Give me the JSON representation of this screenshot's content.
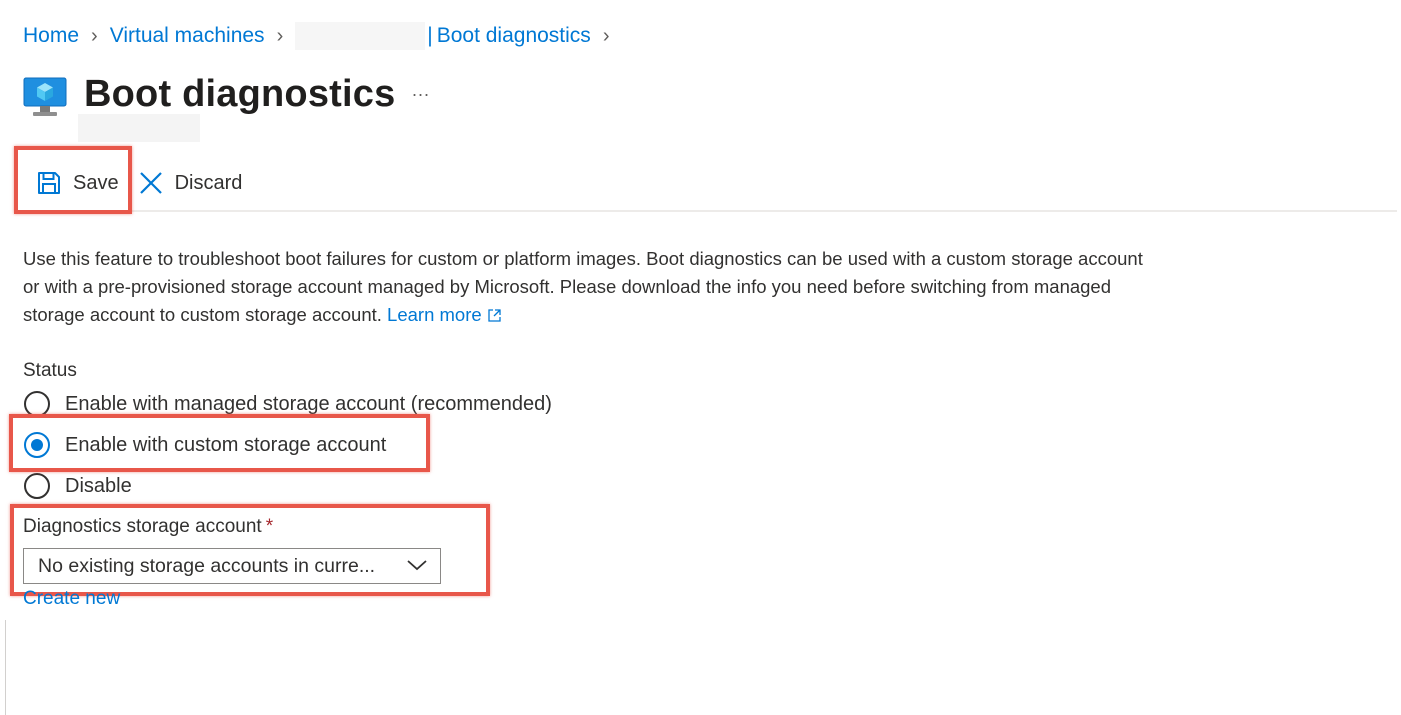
{
  "breadcrumb": {
    "home": "Home",
    "virtual_machines": "Virtual machines",
    "current_separator": "|",
    "current": "Boot diagnostics"
  },
  "page": {
    "title": "Boot diagnostics",
    "more": "..."
  },
  "toolbar": {
    "save_label": "Save",
    "discard_label": "Discard"
  },
  "description": {
    "text": "Use this feature to troubleshoot boot failures for custom or platform images. Boot diagnostics can be used with a custom storage account or with a pre-provisioned storage account managed by Microsoft. Please download the info you need before switching from managed storage account to custom storage account.",
    "learn_more": "Learn more"
  },
  "status": {
    "label": "Status",
    "options": [
      {
        "label": "Enable with managed storage account (recommended)",
        "checked": false
      },
      {
        "label": "Enable with custom storage account",
        "checked": true
      },
      {
        "label": "Disable",
        "checked": false
      }
    ]
  },
  "diagnostics_storage": {
    "label": "Diagnostics storage account",
    "required_marker": "*",
    "selected_value": "No existing storage accounts in curre...",
    "create_new": "Create new"
  },
  "colors": {
    "link": "#0078d4",
    "highlight": "#e8574a",
    "text": "#323130",
    "required": "#a4262c"
  },
  "icons": {
    "vm": "virtual-machine-icon",
    "save": "save-icon",
    "discard": "close-icon",
    "external_link": "external-link-icon",
    "chevron": "chevron-down-icon"
  }
}
